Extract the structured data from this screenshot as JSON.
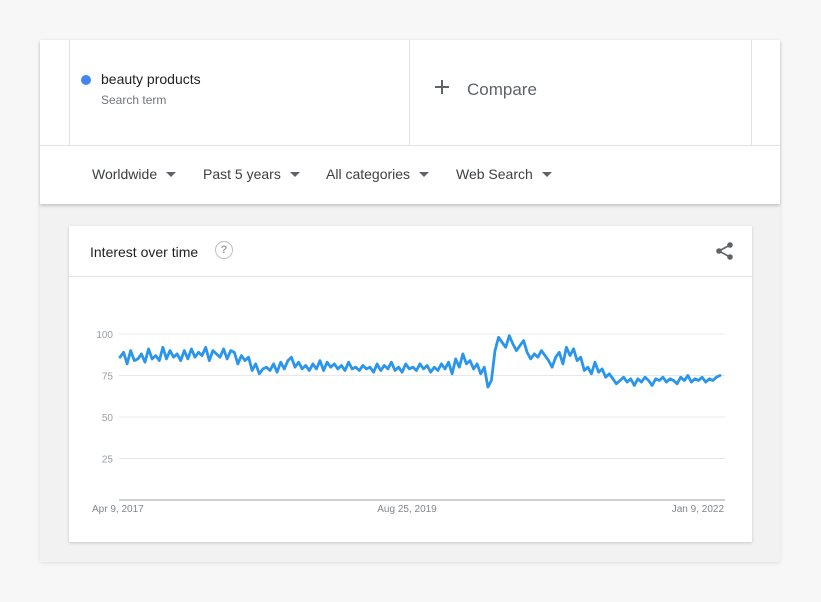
{
  "search_term": {
    "name": "beauty products",
    "subtitle": "Search term",
    "color": "#4285f4"
  },
  "compare": {
    "label": "Compare",
    "icon": "plus-icon"
  },
  "filters": [
    {
      "label": "Worldwide"
    },
    {
      "label": "Past 5 years"
    },
    {
      "label": "All categories"
    },
    {
      "label": "Web Search"
    }
  ],
  "card": {
    "title": "Interest over time",
    "help_icon": "question-circle-icon",
    "share_icon": "share-icon"
  },
  "chart_data": {
    "type": "line",
    "title": "Interest over time",
    "xlabel": "",
    "ylabel": "",
    "x_tick_labels": [
      "Apr 9, 2017",
      "Aug 25, 2019",
      "Jan 9, 2022"
    ],
    "yticks": [
      25,
      50,
      75,
      100
    ],
    "ylim": [
      0,
      100
    ],
    "grid": true,
    "series": [
      {
        "color": "#2a95ea",
        "values": [
          86,
          89,
          82,
          90,
          84,
          85,
          88,
          83,
          91,
          85,
          87,
          84,
          92,
          85,
          90,
          86,
          88,
          84,
          90,
          85,
          91,
          86,
          89,
          87,
          92,
          84,
          90,
          88,
          86,
          91,
          85,
          90,
          89,
          82,
          87,
          84,
          86,
          78,
          82,
          76,
          79,
          80,
          78,
          82,
          77,
          83,
          79,
          84,
          86,
          80,
          83,
          79,
          81,
          78,
          82,
          79,
          84,
          78,
          83,
          80,
          82,
          79,
          81,
          78,
          83,
          79,
          80,
          78,
          81,
          79,
          80,
          77,
          82,
          78,
          81,
          79,
          83,
          78,
          80,
          77,
          82,
          79,
          80,
          78,
          82,
          79,
          81,
          77,
          80,
          78,
          82,
          79,
          83,
          76,
          85,
          80,
          88,
          82,
          84,
          79,
          82,
          76,
          80,
          68,
          72,
          90,
          98,
          95,
          92,
          99,
          94,
          90,
          93,
          96,
          89,
          85,
          88,
          86,
          90,
          87,
          84,
          80,
          86,
          89,
          82,
          92,
          87,
          91,
          84,
          86,
          78,
          80,
          76,
          83,
          77,
          79,
          74,
          76,
          73,
          70,
          72,
          74,
          71,
          73,
          69,
          73,
          71,
          74,
          72,
          69,
          73,
          72,
          74,
          71,
          73,
          72,
          70,
          74,
          72,
          75,
          71,
          73,
          72,
          74,
          71,
          73,
          72,
          74,
          75
        ]
      }
    ]
  }
}
